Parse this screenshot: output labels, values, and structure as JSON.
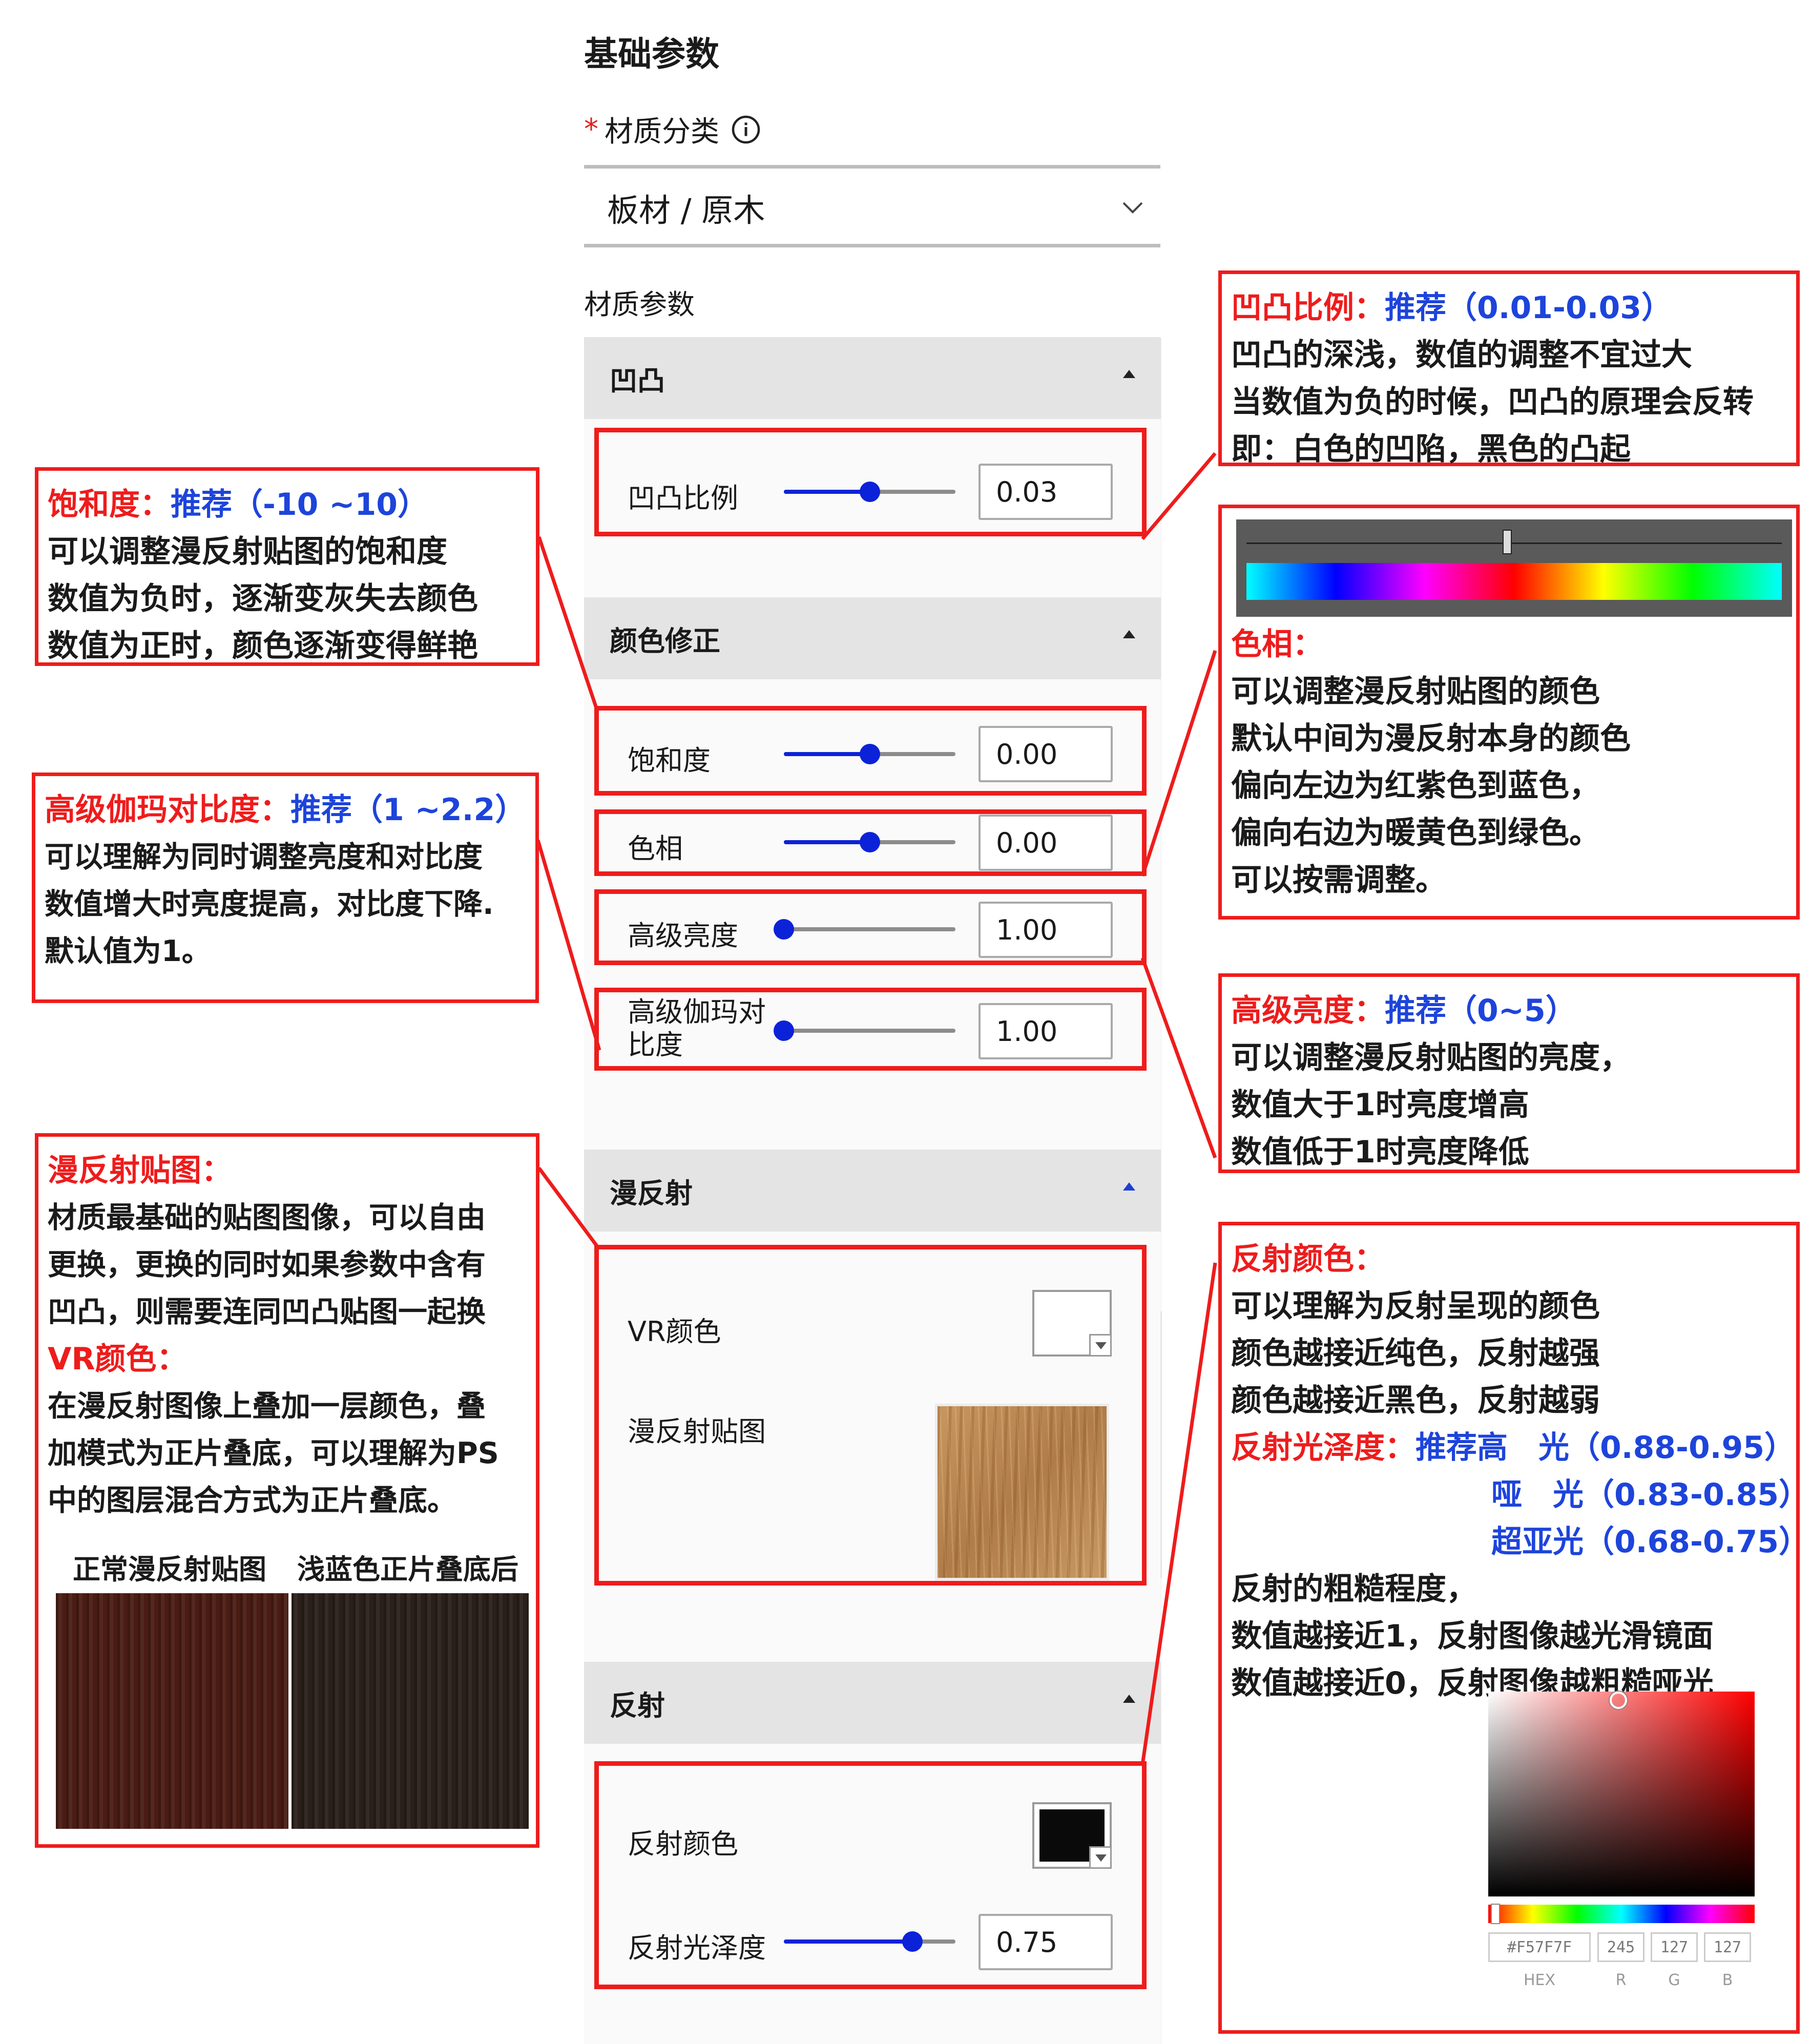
{
  "panel": {
    "title": "基础参数",
    "required_star": "*",
    "category_label": "材质分类",
    "category_value": "板材 / 原木",
    "params_label": "材质参数"
  },
  "sections": {
    "bump": {
      "title": "凹凸",
      "rows": [
        {
          "label": "凹凸比例",
          "value": "0.03",
          "slider": 0.5
        }
      ]
    },
    "color": {
      "title": "颜色修正",
      "rows": [
        {
          "label": "饱和度",
          "value": "0.00",
          "slider": 0.5
        },
        {
          "label": "色相",
          "value": "0.00",
          "slider": 0.5
        },
        {
          "label": "高级亮度",
          "value": "1.00",
          "slider": 0.0
        },
        {
          "label": "高级伽玛对比度",
          "value": "1.00",
          "slider": 0.0
        }
      ]
    },
    "diffuse": {
      "title": "漫反射",
      "vr_color_label": "VR颜色",
      "vr_color": "#ffffff",
      "map_label": "漫反射贴图"
    },
    "reflect": {
      "title": "反射",
      "color_label": "反射颜色",
      "color": "#0a0a0a",
      "gloss_label": "反射光泽度",
      "gloss_value": "0.75",
      "gloss_slider": 0.75
    }
  },
  "notes": {
    "bump": {
      "head": "凹凸比例：",
      "rec": "推荐（0.01-0.03）",
      "lines": [
        "凹凸的深浅，数值的调整不宜过大",
        "当数值为负的时候，凹凸的原理会反转",
        "即：白色的凹陷，黑色的凸起"
      ]
    },
    "saturation": {
      "head": "饱和度：",
      "rec": "推荐（-10 ~10）",
      "lines": [
        "可以调整漫反射贴图的饱和度",
        "数值为负时，逐渐变灰失去颜色",
        "数值为正时，颜色逐渐变得鲜艳"
      ]
    },
    "hue": {
      "head": "色相：",
      "lines": [
        "可以调整漫反射贴图的颜色",
        "默认中间为漫反射本身的颜色",
        "偏向左边为红紫色到蓝色，",
        "偏向右边为暖黄色到绿色。",
        "可以按需调整。"
      ]
    },
    "gamma": {
      "head": "高级伽玛对比度：",
      "rec": "推荐（1 ~2.2）",
      "lines": [
        "可以理解为同时调整亮度和对比度",
        "数值增大时亮度提高，对比度下降.",
        "默认值为1。"
      ]
    },
    "brightness": {
      "head": "高级亮度：",
      "rec": "推荐（0~5）",
      "lines": [
        "可以调整漫反射贴图的亮度，",
        "数值大于1时亮度增高",
        "数值低于1时亮度降低"
      ]
    },
    "diffuse": {
      "head": "漫反射贴图：",
      "lines": [
        "材质最基础的贴图图像，可以自由",
        "更换，更换的同时如果参数中含有",
        "凹凸，则需要连同凹凸贴图一起换"
      ],
      "head2": "VR颜色：",
      "lines2": [
        "在漫反射图像上叠加一层颜色，叠",
        "加模式为正片叠底，可以理解为PS",
        "中的图层混合方式为正片叠底。"
      ],
      "img_label_1": "正常漫反射贴图",
      "img_label_2": "浅蓝色正片叠底后",
      "img_color_1": "#4a1c14",
      "img_color_2": "#2a201a"
    },
    "reflect": {
      "head": "反射颜色：",
      "lines": [
        "可以理解为反射呈现的颜色",
        "颜色越接近纯色，反射越强",
        "颜色越接近黑色，反射越弱"
      ],
      "head2": "反射光泽度：",
      "rec_lines": [
        "推荐高　光（0.88-0.95）",
        "哑　光（0.83-0.85）",
        "超亚光（0.68-0.75）"
      ],
      "lines2": [
        "反射的粗糙程度，",
        "数值越接近1，反射图像越光滑镜面",
        "数值越接近0，反射图像越粗糙哑光"
      ]
    }
  },
  "color_picker": {
    "hex": "#F57F7F",
    "r": "245",
    "g": "127",
    "b": "127",
    "hex_label": "HEX",
    "r_label": "R",
    "g_label": "G",
    "b_label": "B",
    "base_color": "#ff0000"
  }
}
